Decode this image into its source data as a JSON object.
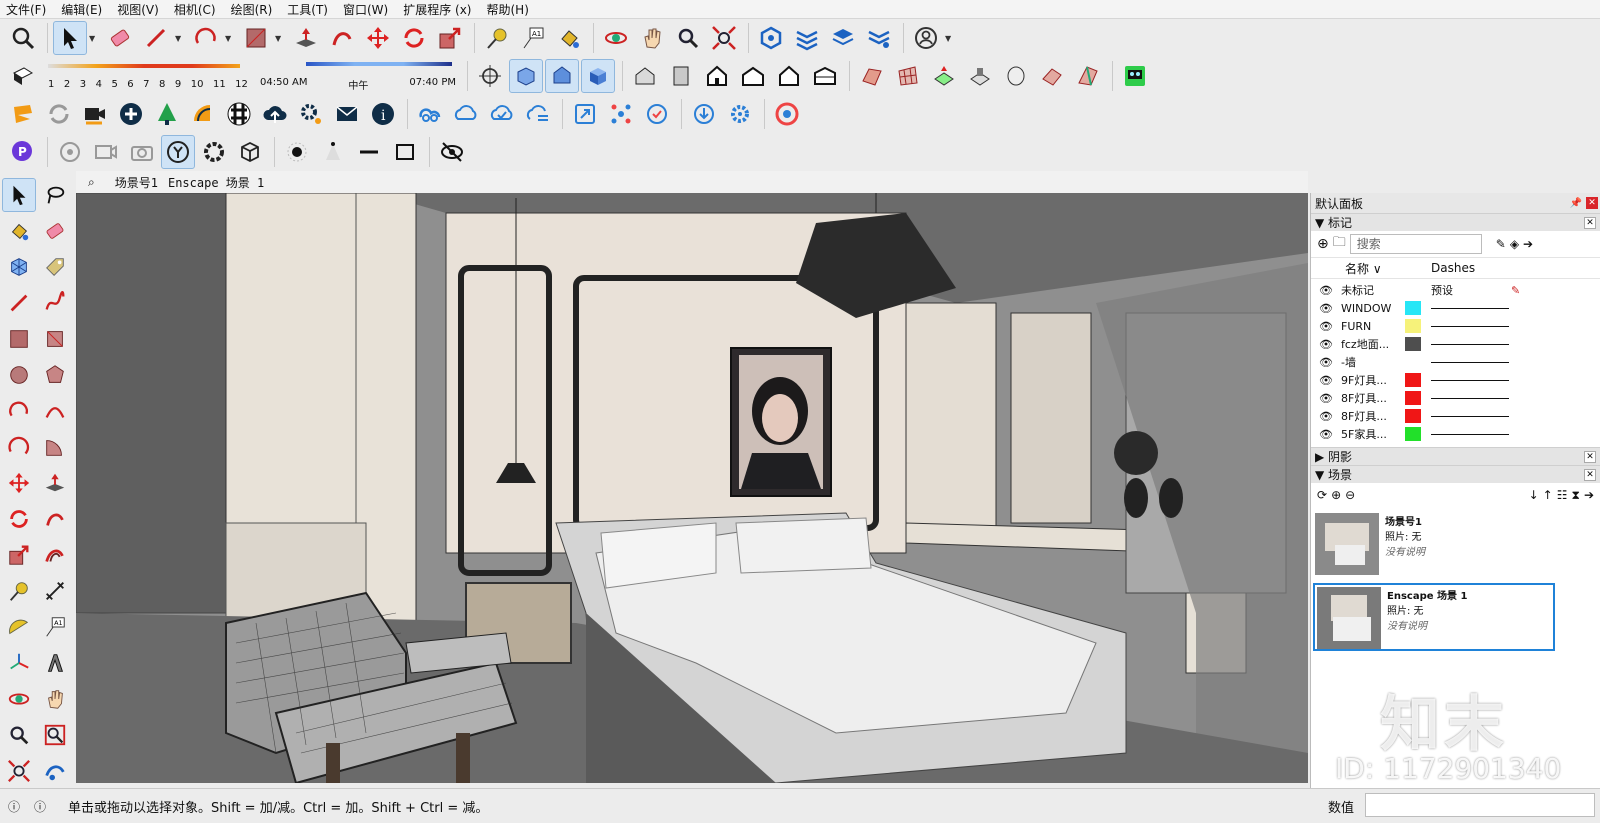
{
  "menu": [
    "文件(F)",
    "编辑(E)",
    "视图(V)",
    "相机(C)",
    "绘图(R)",
    "工具(T)",
    "窗口(W)",
    "扩展程序 (x)",
    "帮助(H)"
  ],
  "shadow_slider": {
    "months": [
      "1",
      "2",
      "3",
      "4",
      "5",
      "6",
      "7",
      "8",
      "9",
      "10",
      "11",
      "12"
    ],
    "time_start": "04:50 AM",
    "time_mid": "中午",
    "time_end": "07:40 PM"
  },
  "scene_tabs": [
    "场景号1",
    "Enscape 场景 1"
  ],
  "panel": {
    "title": "默认面板",
    "tags_title": "标记",
    "search_placeholder": "搜索",
    "col_name": "名称",
    "col_dashes": "Dashes",
    "tags": [
      {
        "name": "未标记",
        "color": "",
        "dashes": "预设"
      },
      {
        "name": "WINDOW",
        "color": "#27e6f6",
        "dashes": ""
      },
      {
        "name": "FURN",
        "color": "#f6f27a",
        "dashes": ""
      },
      {
        "name": "fcz地面...",
        "color": "#4e4e4e",
        "dashes": ""
      },
      {
        "name": "-墙",
        "color": "",
        "dashes": ""
      },
      {
        "name": "9F灯具...",
        "color": "#f01616",
        "dashes": ""
      },
      {
        "name": "8F灯具...",
        "color": "#f01616",
        "dashes": ""
      },
      {
        "name": "8F灯具...",
        "color": "#f01616",
        "dashes": ""
      },
      {
        "name": "5F家具...",
        "color": "#22e02a",
        "dashes": ""
      }
    ],
    "shadow_title": "阴影",
    "scenes_title": "场景",
    "scenes": [
      {
        "name": "场景号1",
        "photo": "照片: 无",
        "desc": "没有说明"
      },
      {
        "name": "Enscape 场景 1",
        "photo": "照片: 无",
        "desc": "没有说明"
      }
    ]
  },
  "status": {
    "message": "单击或拖动以选择对象。Shift = 加/减。Ctrl = 加。Shift + Ctrl = 减。",
    "value_label": "数值"
  },
  "watermark": {
    "brand": "知末",
    "id": "ID: 1172901340"
  },
  "colors": {
    "accent": "#1f82d8",
    "close": "#d9252a"
  }
}
